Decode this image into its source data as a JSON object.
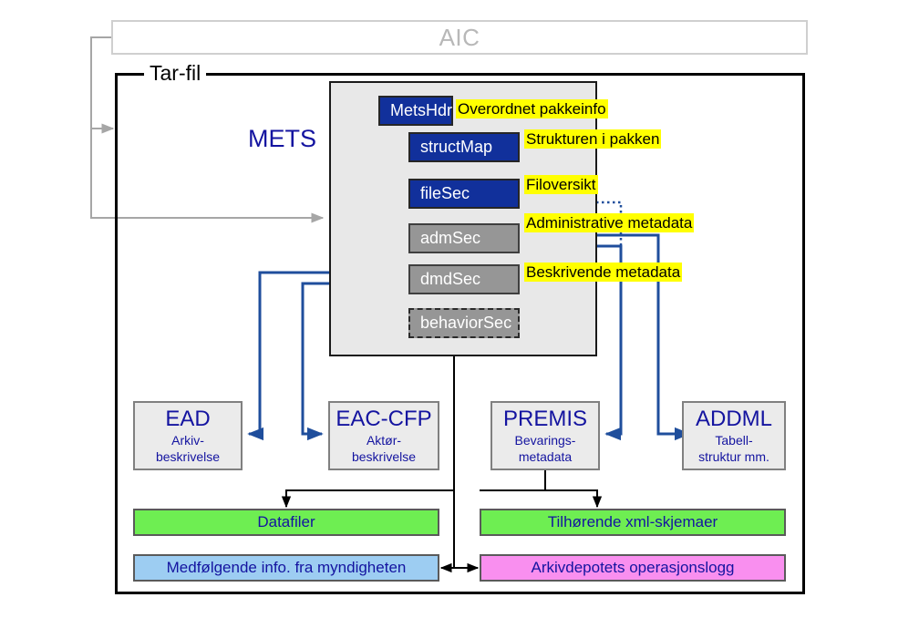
{
  "diagram": {
    "title": "AIC / Tar-fil METS package structure",
    "outer": {
      "aic_label": "AIC",
      "tarfil_label": "Tar-fil"
    },
    "mets": {
      "label": "METS",
      "sections": [
        {
          "id": "metshdr",
          "label": "MetsHdr",
          "style": "blue",
          "caption": "Overordnet pakkeinfo"
        },
        {
          "id": "structmap",
          "label": "structMap",
          "style": "blue",
          "caption": "Strukturen i pakken"
        },
        {
          "id": "filesec",
          "label": "fileSec",
          "style": "blue",
          "caption": "Filoversikt"
        },
        {
          "id": "admsec",
          "label": "admSec",
          "style": "gray",
          "caption": "Administrative metadata"
        },
        {
          "id": "dmdsec",
          "label": "dmdSec",
          "style": "gray",
          "caption": "Beskrivende metadata"
        },
        {
          "id": "behaviorsec",
          "label": "behaviorSec",
          "style": "dashed",
          "caption": ""
        }
      ]
    },
    "formats": [
      {
        "id": "ead",
        "title": "EAD",
        "sub1": "Arkiv-",
        "sub2": "beskrivelse"
      },
      {
        "id": "eac-cfp",
        "title": "EAC-CFP",
        "sub1": "Aktør-",
        "sub2": "beskrivelse"
      },
      {
        "id": "premis",
        "title": "PREMIS",
        "sub1": "Bevarings-",
        "sub2": "metadata"
      },
      {
        "id": "addml",
        "title": "ADDML",
        "sub1": "Tabell-",
        "sub2": "struktur mm."
      }
    ],
    "bars": [
      {
        "id": "datafiler",
        "label": "Datafiler",
        "color_name": "green",
        "color": "#6EEE52"
      },
      {
        "id": "xml-skjemaer",
        "label": "Tilhørende xml-skjemaer",
        "color_name": "green",
        "color": "#6EEE52"
      },
      {
        "id": "medfolgende",
        "label": "Medfølgende info. fra myndigheten",
        "color_name": "blue",
        "color": "#9DCDF2"
      },
      {
        "id": "operasjonslogg",
        "label": "Arkivdepotets operasjonslogg",
        "color_name": "pink",
        "color": "#F98FEF"
      }
    ],
    "palette": {
      "section_blue": "#11309B",
      "section_gray": "#969696",
      "mets_panel": "#E8E8E8",
      "highlight": "#FFFF00",
      "text_blue": "#1414A0",
      "connector_blue": "#1F4E9C",
      "connector_red": "#FF4040",
      "connector_gray": "#A6A6A6",
      "connector_black": "#000000"
    }
  }
}
